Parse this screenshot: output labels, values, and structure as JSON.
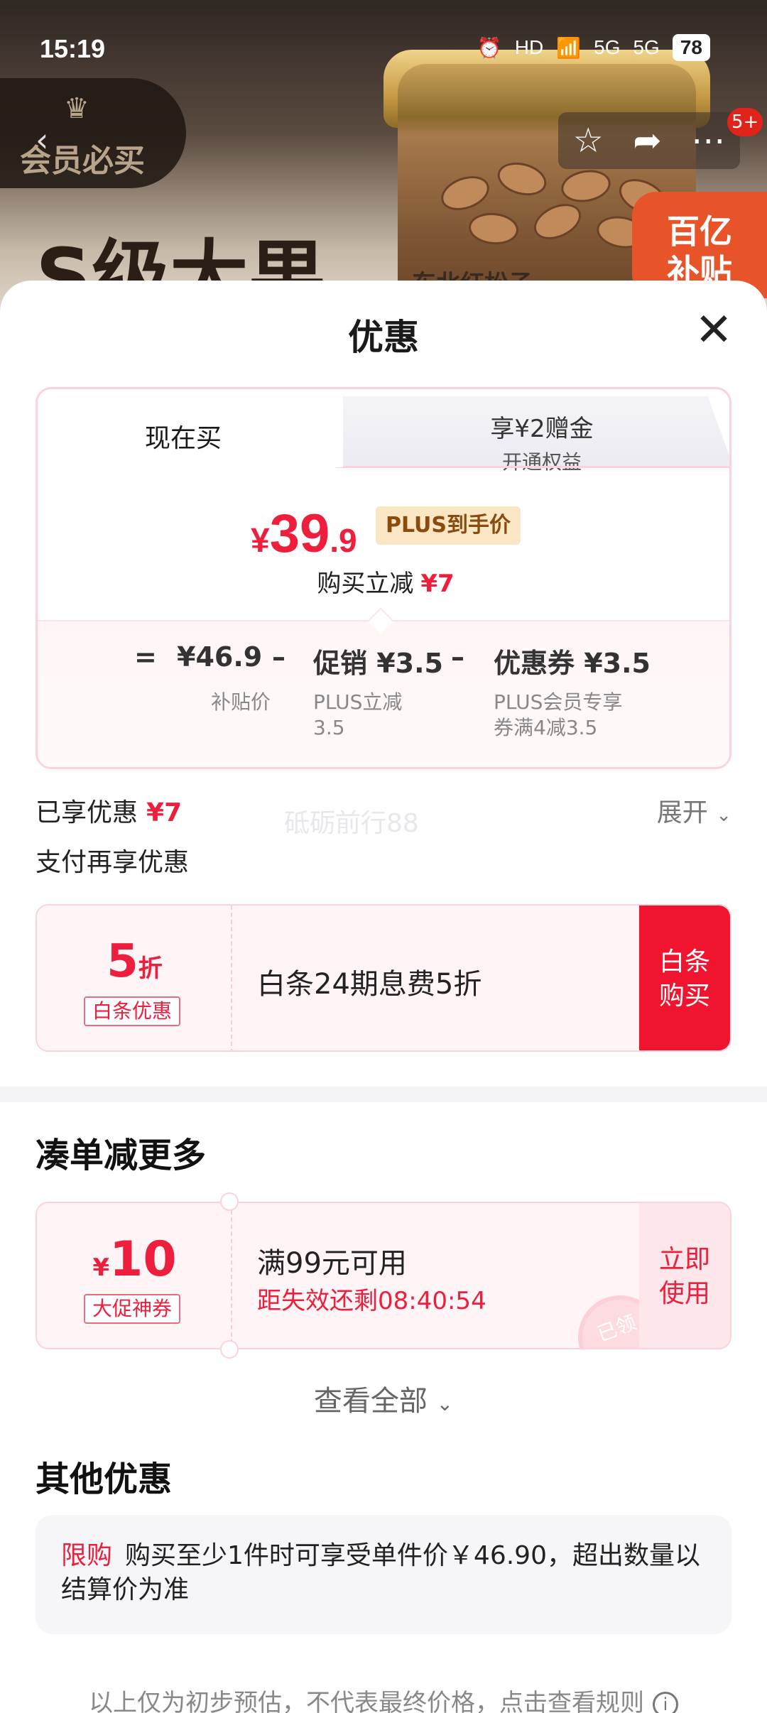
{
  "status_bar": {
    "time": "15:19",
    "battery": "78",
    "network1": "5G",
    "network2": "5G",
    "hd": "HD"
  },
  "hero": {
    "member_tag": "会员必买",
    "title": "S级大果",
    "subtitle": "东北红松子",
    "subsidy": "百亿\n补贴",
    "badge": "5+"
  },
  "sheet": {
    "title": "优惠",
    "tabs": {
      "now": "现在买",
      "plus_line1": "享¥2赠金",
      "plus_line2": "开通权益"
    },
    "price": {
      "currency": "¥",
      "integer": "39",
      "decimal": ".9",
      "plus_tag": "PLUS到手价"
    },
    "reduce": {
      "label": "购买立减",
      "amount": "¥7"
    },
    "formula": {
      "equals": "=",
      "minus": "–",
      "base": "¥46.9",
      "base_label": "补贴价",
      "promo": "促销 ¥3.5",
      "promo_label": "PLUS立减\n3.5",
      "coupon": "优惠券 ¥3.5",
      "coupon_label": "PLUS会员专享\n券满4减3.5"
    },
    "enjoyed": {
      "label": "已享优惠",
      "amount": "¥7",
      "expand": "展开"
    },
    "watermark": "砥砺前行88",
    "pay_title": "支付再享优惠",
    "baitiao": {
      "discount": "5",
      "unit": "折",
      "chip": "白条优惠",
      "desc": "白条24期息费5折",
      "button": "白条\n购买"
    },
    "more_title": "凑单减更多",
    "coupon": {
      "currency": "¥",
      "value": "10",
      "chip": "大促神券",
      "condition": "满99元可用",
      "timer": "距失效还剩08:40:54",
      "button": "立即\n使用",
      "stamp": "已领"
    },
    "view_all": "查看全部",
    "other_title": "其他优惠",
    "limit": {
      "tag": "限购",
      "text": "购买至少1件时可享受单件价￥46.90，超出数量以结算价为准"
    },
    "footer": "以上仅为初步预估，不代表最终价格，点击查看规则"
  }
}
